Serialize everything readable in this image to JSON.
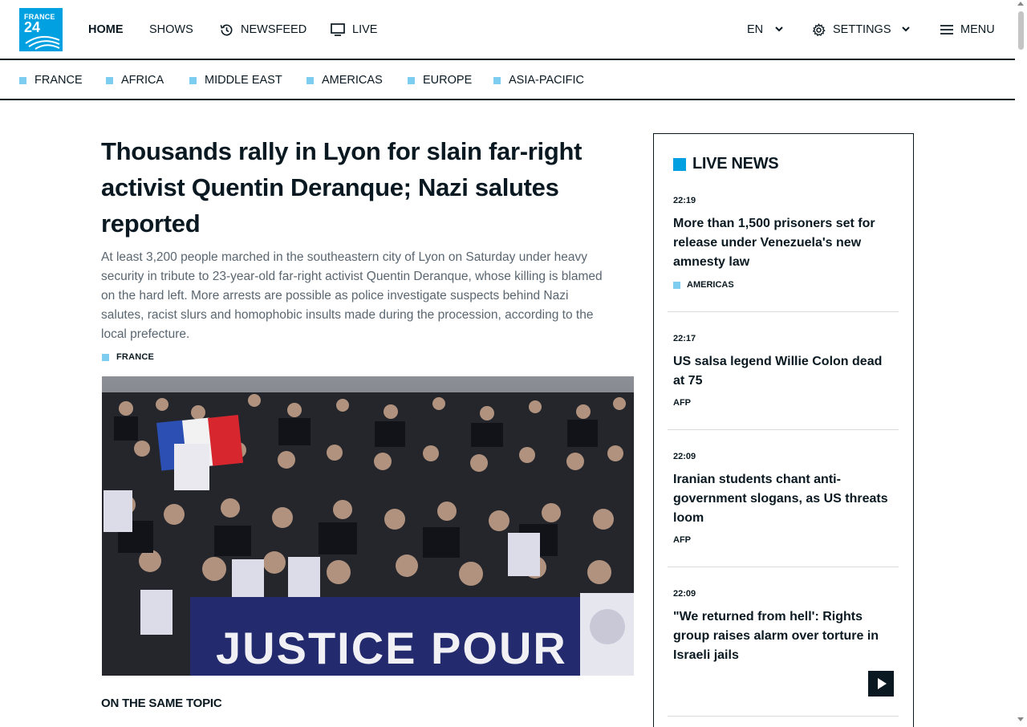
{
  "logo": {
    "line1": "FRANCE",
    "line2": "24"
  },
  "nav": {
    "home": "HOME",
    "shows": "SHOWS",
    "newsfeed": "NEWSFEED",
    "live": "LIVE",
    "language": "EN",
    "settings": "SETTINGS",
    "menu": "MENU"
  },
  "regions": [
    "FRANCE",
    "AFRICA",
    "MIDDLE EAST",
    "AMERICAS",
    "EUROPE",
    "ASIA-PACIFIC"
  ],
  "article": {
    "headline": "Thousands rally in Lyon for slain far-right activist Quentin Deranque; Nazi salutes reported",
    "lede": "At least 3,200 people marched in the southeastern city of Lyon on Saturday under heavy security in tribute to 23-year-old far-right activist Quentin Deranque, whose killing is blamed on the hard left. More arrests are possible as police investigate suspects behind Nazi salutes, racist slurs and homophobic insults made during the procession, according to the local prefecture.",
    "tag": "FRANCE",
    "photo_banner": "JUSTICE POUR QUENTIN",
    "same_topic": "ON THE SAME TOPIC"
  },
  "live_news": {
    "title": "LIVE NEWS",
    "items": [
      {
        "time": "22:19",
        "title": "More than 1,500 prisoners set for release under Venezuela's new amnesty law",
        "source": "AMERICAS"
      },
      {
        "time": "22:17",
        "title": "US salsa legend Willie Colon dead at 75",
        "source": "AFP"
      },
      {
        "time": "22:09",
        "title": "Iranian students chant anti-government slogans, as US threats loom",
        "source": "AFP"
      },
      {
        "time": "22:09",
        "title": "\"We returned from hell': Rights group raises alarm over torture in Israeli jails",
        "source": ""
      }
    ]
  },
  "colors": {
    "accent": "#00a0e1",
    "tag_square": "#7dcdf1",
    "ink": "#0a1921"
  }
}
